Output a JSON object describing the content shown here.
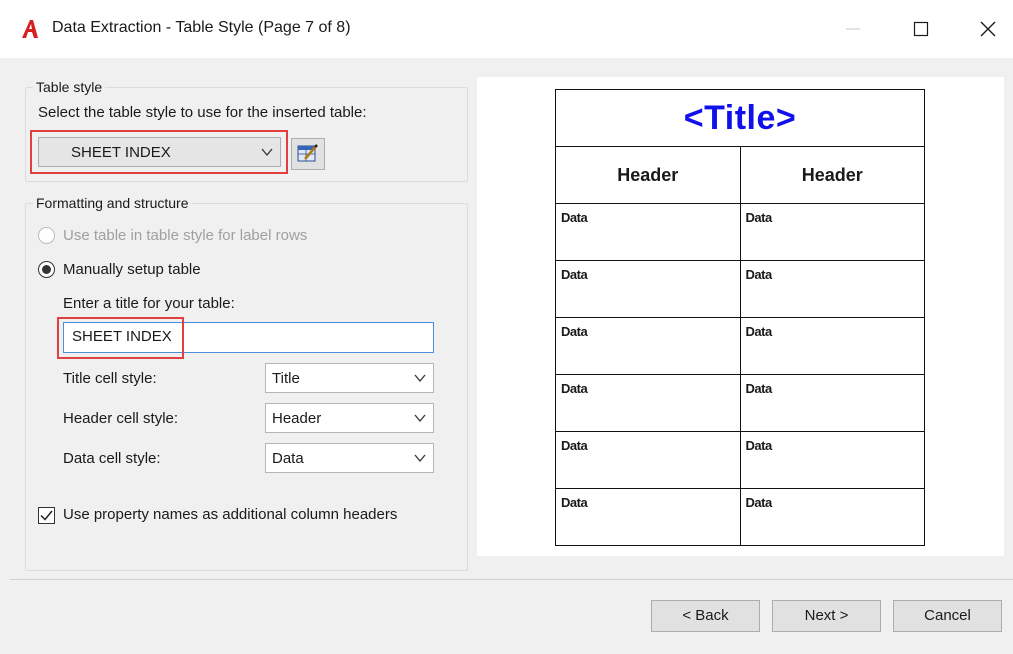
{
  "window": {
    "title": "Data Extraction - Table Style (Page 7 of 8)",
    "app_icon": "autocad-a-icon",
    "accent_color": "#e04040"
  },
  "table_style_group": {
    "legend": "Table style",
    "prompt": "Select the table style to use for the inserted table:",
    "selected_style": "SHEET INDEX"
  },
  "formatting_group": {
    "legend": "Formatting and structure",
    "option_use_table_style": "Use table in table style for label rows",
    "option_manual": "Manually setup table",
    "title_prompt": "Enter a title for your table:",
    "title_value": "SHEET INDEX",
    "title_cell_label": "Title cell style:",
    "title_cell_value": "Title",
    "header_cell_label": "Header cell style:",
    "header_cell_value": "Header",
    "data_cell_label": "Data cell style:",
    "data_cell_value": "Data",
    "use_property_names": "Use property names as additional column headers"
  },
  "preview": {
    "title": "<Title>",
    "headers": [
      "Header",
      "Header"
    ],
    "rows": [
      [
        "Data",
        "Data"
      ],
      [
        "Data",
        "Data"
      ],
      [
        "Data",
        "Data"
      ],
      [
        "Data",
        "Data"
      ],
      [
        "Data",
        "Data"
      ],
      [
        "Data",
        "Data"
      ]
    ],
    "title_color": "#1010ee"
  },
  "buttons": {
    "back": "< Back",
    "next": "Next >",
    "cancel": "Cancel"
  }
}
